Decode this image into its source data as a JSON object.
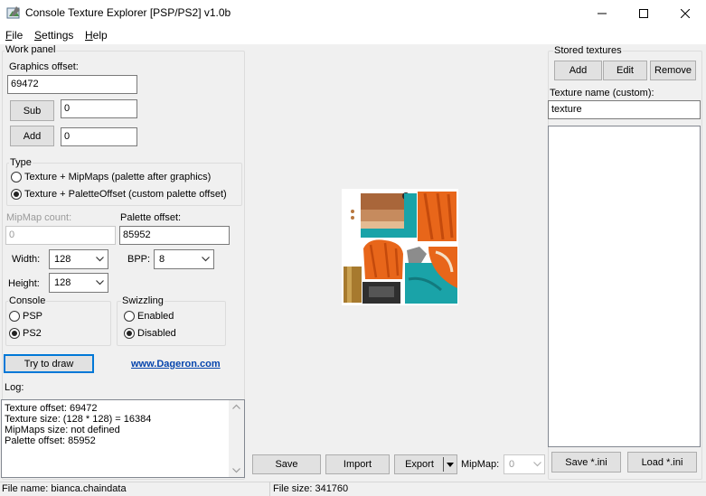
{
  "window": {
    "title": "Console Texture Explorer [PSP/PS2] v1.0b",
    "minimize_glyph": "—",
    "maximize_glyph": "☐",
    "close_glyph": "✕"
  },
  "menu": {
    "file": {
      "accel": "F",
      "rest": "ile"
    },
    "settings": {
      "accel": "S",
      "rest": "ettings"
    },
    "help": {
      "accel": "H",
      "rest": "elp"
    }
  },
  "work_panel": {
    "title": "Work panel",
    "graphics_offset_label": "Graphics offset:",
    "graphics_offset_value": "69472",
    "sub_button": "Sub",
    "sub_value": "0",
    "add_button": "Add",
    "add_value": "0",
    "type": {
      "title": "Type",
      "option_mipmaps": "Texture + MipMaps (palette after graphics)",
      "option_palette_offset": "Texture + PaletteOffset (custom palette offset)",
      "selected": "palette_offset"
    },
    "mipmap_count_label": "MipMap count:",
    "mipmap_count_value": "0",
    "palette_offset_label": "Palette offset:",
    "palette_offset_value": "85952",
    "width_label": "Width:",
    "width_value": "128",
    "bpp_label": "BPP:",
    "bpp_value": "8",
    "height_label": "Height:",
    "height_value": "128",
    "console": {
      "title": "Console",
      "psp": "PSP",
      "ps2": "PS2",
      "selected": "ps2"
    },
    "swizzling": {
      "title": "Swizzling",
      "enabled": "Enabled",
      "disabled": "Disabled",
      "selected": "disabled"
    },
    "try_button": "Try to draw",
    "website_link": "www.Dageron.com",
    "log_label": "Log:",
    "log_lines": [
      "Texture offset: 69472",
      "Texture size: (128 * 128) = 16384",
      "MipMaps size: not defined",
      "Palette offset: 85952"
    ]
  },
  "center": {
    "save_button": "Save",
    "import_button": "Import",
    "export_button": "Export",
    "mipmap_label": "MipMap:",
    "mipmap_value": "0"
  },
  "stored": {
    "title": "Stored textures",
    "add_button": "Add",
    "edit_button": "Edit",
    "remove_button": "Remove",
    "texture_name_label": "Texture name (custom):",
    "texture_name_value": "texture",
    "save_ini_button": "Save *.ini",
    "load_ini_button": "Load *.ini"
  },
  "status": {
    "file_name": "File name: bianca.chaindata",
    "file_size": "File size: 341760"
  },
  "colors": {
    "accent": "#0078d7",
    "link": "#0645ad",
    "texture_orange": "#e8661a",
    "texture_teal": "#1aa3a8",
    "texture_skin": "#c68b5e"
  }
}
